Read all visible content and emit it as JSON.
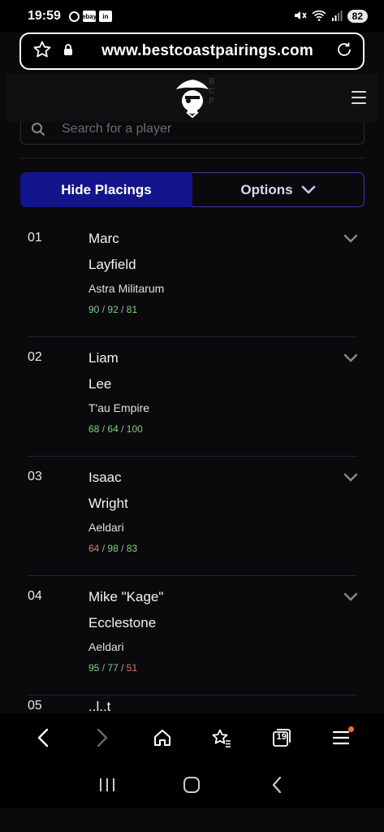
{
  "status_bar": {
    "time": "19:59",
    "app_icons": [
      "ebay",
      "in"
    ],
    "battery": "82"
  },
  "url_bar": {
    "url": "www.bestcoastpairings.com"
  },
  "site": {
    "logo_letters": [
      "B",
      "C",
      "P"
    ]
  },
  "search": {
    "placeholder": "Search for a player"
  },
  "buttons": {
    "hide_placings": "Hide Placings",
    "options": "Options"
  },
  "players": [
    {
      "place": "01",
      "first": "Marc",
      "last": "Layfield",
      "faction": "Astra Militarum",
      "scores": [
        {
          "v": "90",
          "c": "good"
        },
        {
          "v": "92",
          "c": "good"
        },
        {
          "v": "81",
          "c": "good"
        }
      ]
    },
    {
      "place": "02",
      "first": "Liam",
      "last": "Lee",
      "faction": "T'au Empire",
      "scores": [
        {
          "v": "68",
          "c": "good"
        },
        {
          "v": "64",
          "c": "good"
        },
        {
          "v": "100",
          "c": "good"
        }
      ]
    },
    {
      "place": "03",
      "first": "Isaac",
      "last": "Wright",
      "faction": "Aeldari",
      "scores": [
        {
          "v": "64",
          "c": "bad"
        },
        {
          "v": "98",
          "c": "good"
        },
        {
          "v": "83",
          "c": "good"
        }
      ]
    },
    {
      "place": "04",
      "first": "Mike \"Kage\"",
      "last": "Ecclestone",
      "faction": "Aeldari",
      "scores": [
        {
          "v": "95",
          "c": "good"
        },
        {
          "v": "77",
          "c": "good"
        },
        {
          "v": "51",
          "c": "bad"
        }
      ]
    }
  ],
  "partial_player": {
    "place": "05",
    "first": "..l..t"
  },
  "score_separator": "/",
  "toolbar": {
    "tabs_count": "19"
  },
  "colors": {
    "accent_blue": "#14148c",
    "score_good": "#7fd17f",
    "score_bad": "#e07a70",
    "notification": "#ff6a2b"
  }
}
